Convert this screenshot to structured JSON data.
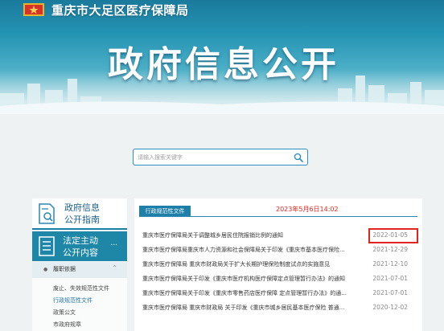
{
  "header": {
    "site_name": "重庆市大足区医疗保障局",
    "page_title": "政府信息公开"
  },
  "search": {
    "placeholder": "请输入搜索关键字"
  },
  "sidebar": {
    "guide_label_line1": "政府信息",
    "guide_label_line2": "公开指南",
    "active_label_line1": "法定主动",
    "active_label_line2": "公开内容",
    "active_more": "...",
    "group_label": "履职依据",
    "items": [
      "废止、失效规范性文件",
      "行政规范性文件",
      "政策公文",
      "市政府规章"
    ]
  },
  "main": {
    "tab_label": "行政规范性文件",
    "datetime": "2023年5月6日14:02",
    "rows": [
      {
        "title": "重庆市医疗保障局关于调整城乡居民住院报销比例的通知",
        "date": "2022-01-05"
      },
      {
        "title": "重庆市医疗保障局重庆市人力资源和社会保障局关于印发《重庆市基本医疗保险...",
        "date": "2021-12-29"
      },
      {
        "title": "重庆市医疗保障局 重庆市财政局关于扩大长期护理保险制度试点的实施意见",
        "date": "2021-12-10"
      },
      {
        "title": "重庆市医疗保障局关于印发《重庆市医疗机构医疗保障定点管理暂行办法》的通知",
        "date": "2021-07-01"
      },
      {
        "title": "重庆市医疗保障局关于印发《重庆市零售药店医疗保障 定点管理暂行办法》的通...",
        "date": "2021-07-01"
      },
      {
        "title": "重庆市医疗保障局 重庆市财政局 关于印发《重庆市城乡居民基本医疗保险 普通...",
        "date": "2020-12-02"
      }
    ]
  },
  "colors": {
    "accent": "#1e87a8",
    "highlight": "#e0251f",
    "banner_top": "#1a7a9c"
  }
}
